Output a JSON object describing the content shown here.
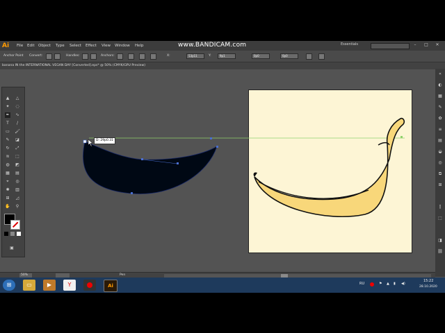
{
  "app": {
    "logo": "Ai",
    "menus": [
      "File",
      "Edit",
      "Object",
      "Type",
      "Select",
      "Effect",
      "View",
      "Window",
      "Help"
    ],
    "workspace": "Essentials",
    "watermark": "www.BANDICAM.com"
  },
  "controlbar": {
    "anchor_point": "Anchor Point",
    "convert": "Convert:",
    "handles": "Handles:",
    "anchors": "Anchors:",
    "x_value": "53p11",
    "y_value": "9p1",
    "w_value": "0p0",
    "h_value": "0p0"
  },
  "document": {
    "tab_title": "banana IN the INTERNATIONAL VEGAN DAY [Converted].eps* @ 50% (CMYK/GPU Preview)"
  },
  "canvas": {
    "tooltip": "D: 29p0.31",
    "path_fill": "#000814",
    "banana_fill": "#f8d77a",
    "artboard_color": "#fdf5d5",
    "guide_color": "#8fd26b"
  },
  "statusbar": {
    "zoom": "50%",
    "tool": "Pen"
  },
  "taskbar": {
    "lang": "RU",
    "time": "15:22",
    "date": "28.10.2020"
  },
  "icons": [
    "selection-icon",
    "direct-selection-icon",
    "pen-icon",
    "type-icon",
    "line-icon",
    "rectangle-icon",
    "brush-icon",
    "pencil-icon",
    "eraser-icon",
    "rotate-icon",
    "scale-icon",
    "warp-icon",
    "hand-icon",
    "zoom-icon"
  ]
}
